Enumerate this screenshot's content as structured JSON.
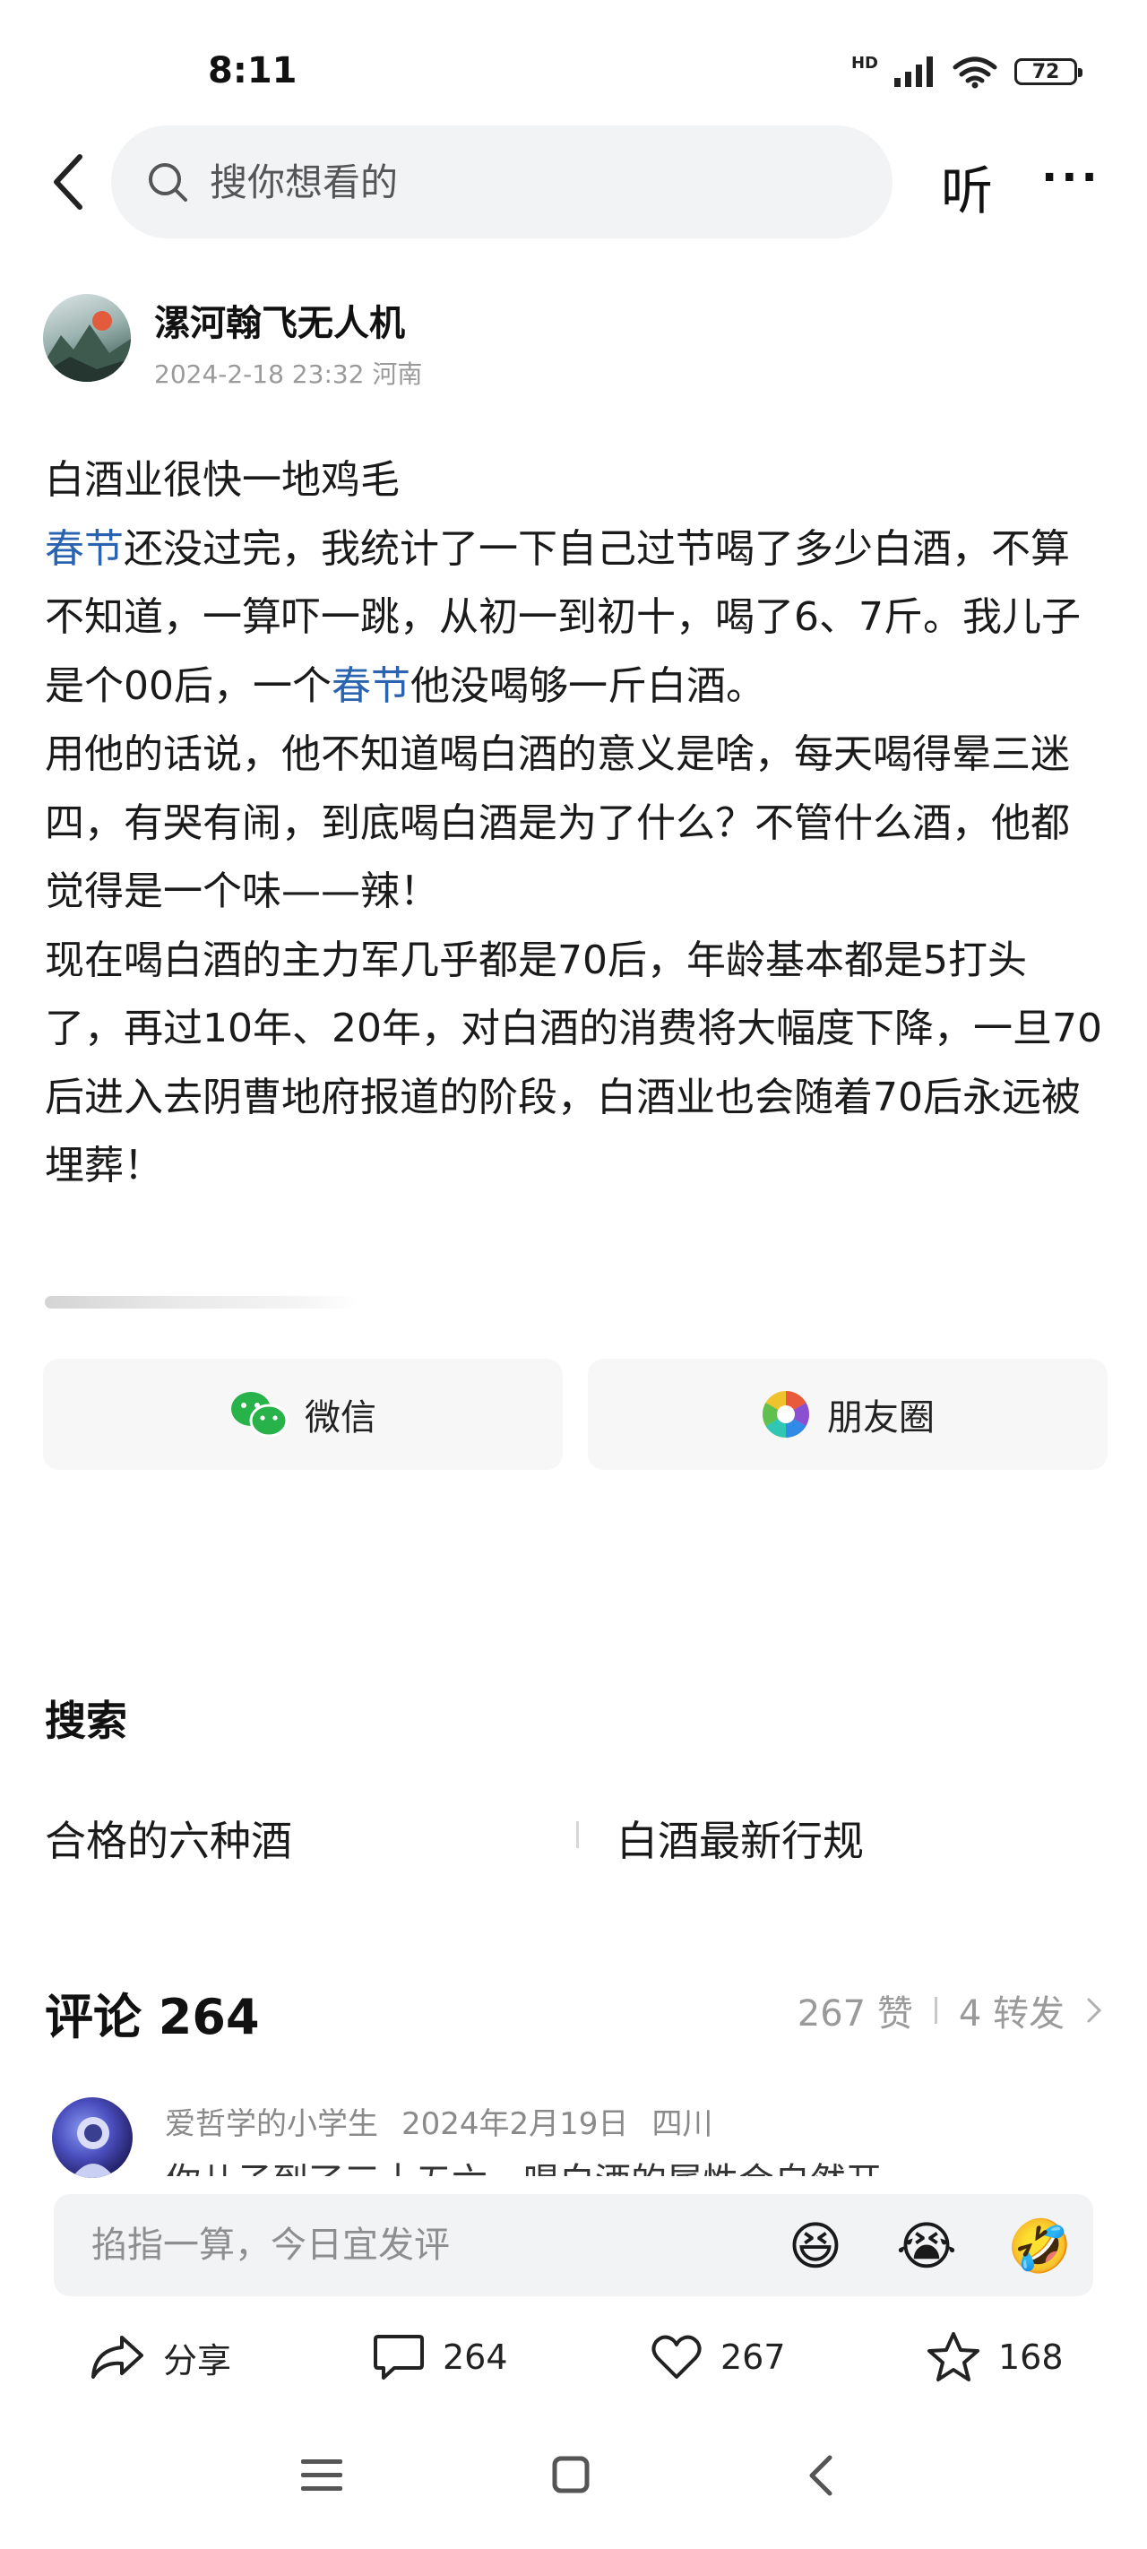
{
  "status_bar": {
    "time": "8:11",
    "network": "HD",
    "battery": "72"
  },
  "header": {
    "search_placeholder": "搜你想看的",
    "listen_label": "听",
    "more_label": "···"
  },
  "author": {
    "name": "漯河翰飞无人机",
    "meta": "2024-2-18 23:32 河南"
  },
  "article": {
    "title_line": "白酒业很快一地鸡毛",
    "topic_1": "春节",
    "p1_a": "还没过完，我统计了一下自己过节喝了多少白酒，不算不知道，一算吓一跳，从初一到初十，喝了6、7斤。我儿子是个00后，一个",
    "topic_2": "春节",
    "p1_b": "他没喝够一斤白酒。",
    "p2": "用他的话说，他不知道喝白酒的意义是啥，每天喝得晕三迷四，有哭有闹，到底喝白酒是为了什么？不管什么酒，他都觉得是一个味——辣！",
    "p3": "现在喝白酒的主力军几乎都是70后，年龄基本都是5打头了，再过10年、20年，对白酒的消费将大幅度下降，一旦70后进入去阴曹地府报道的阶段，白酒业也会随着70后永远被埋葬！"
  },
  "share": {
    "wechat_label": "微信",
    "moments_label": "朋友圈"
  },
  "related_search": {
    "title": "搜索",
    "items": [
      "合格的六种酒",
      "白酒最新行规"
    ]
  },
  "comments": {
    "title": "评论 264",
    "likes": "267 赞",
    "reposts": "4 转发",
    "first": {
      "user": "爱哲学的小学生",
      "date": "2024年2月19日",
      "location": "四川",
      "text": "你儿子到了三十五六，喝白酒的属性会自然开"
    }
  },
  "comment_input": {
    "placeholder": "掐指一算，今日宜发评",
    "emojis": [
      "😆",
      "😭",
      "🤣"
    ]
  },
  "action_bar": {
    "share_label": "分享",
    "comment_count": "264",
    "like_count": "267",
    "fav_count": "168"
  },
  "colors": {
    "topic": "#2a64b0",
    "muted": "#9a9a9a",
    "card_bg": "#f7f7f7",
    "input_bg": "#f2f3f5"
  }
}
